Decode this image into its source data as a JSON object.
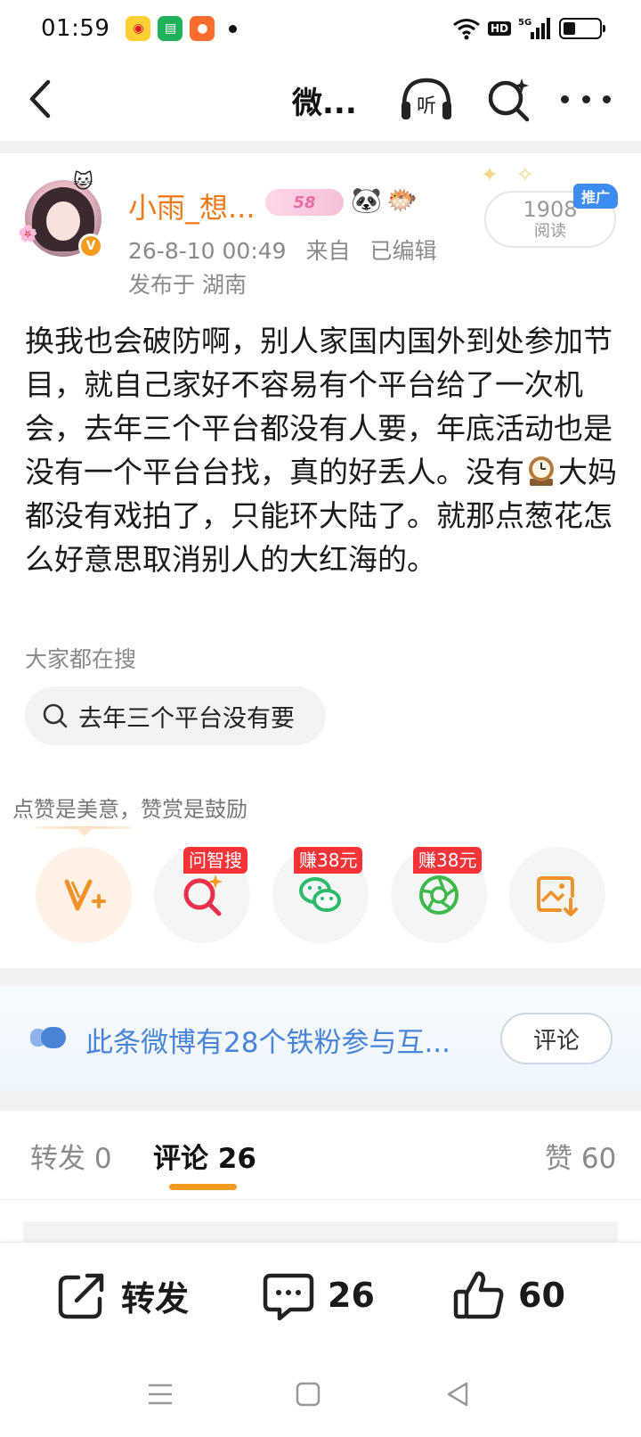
{
  "status_bar": {
    "time": "01:59",
    "network": "5G",
    "hd": "HD",
    "battery_percent": 35
  },
  "nav": {
    "title": "微...",
    "listen_label": "听"
  },
  "post": {
    "user_name": "小雨_想...",
    "level": "58",
    "verified": "V",
    "timestamp": "26-8-10 00:49",
    "source": "来自",
    "edited": "已编辑",
    "location": "发布于 湖南",
    "promo": {
      "count": "1908",
      "count_label": "阅读",
      "tag": "推广"
    },
    "text_part1": "换我也会破防啊，别人家国内国外到处参加节目，就自己家好不容易有个平台给了一次机会，去年三个平台都没有人要，年底活动也是没有一个平台台找，真的好丢人。没有",
    "text_part2": "大妈都没有戏拍了，只能环大陆了。就那点葱花怎么好意思取消别人的大红海的。",
    "search_caption": "大家都在搜",
    "search_chip": "去年三个平台没有要"
  },
  "encourage": {
    "text": "点赞是美意，赞赏是鼓励"
  },
  "actions": [
    {
      "name": "reward",
      "icon": "v-plus-icon",
      "tag": ""
    },
    {
      "name": "ask-search",
      "icon": "ai-search-icon",
      "tag": "问智搜"
    },
    {
      "name": "wechat",
      "icon": "wechat-icon",
      "tag": "赚38元"
    },
    {
      "name": "moments",
      "icon": "moments-icon",
      "tag": "赚38元"
    },
    {
      "name": "save-image",
      "icon": "image-download-icon",
      "tag": ""
    }
  ],
  "fans_banner": {
    "text": "此条微博有28个铁粉参与互...",
    "button": "评论"
  },
  "tabs": {
    "repost": "转发 0",
    "comment": "评论 26",
    "like": "赞 60"
  },
  "bottom_bar": {
    "repost": "转发",
    "comment": "26",
    "like": "60"
  },
  "colors": {
    "accent_orange": "#f59b1f",
    "username_orange": "#ee7a19",
    "link_blue": "#4a84d6",
    "tag_red": "#f5343a",
    "promo_blue": "#3d8cf0"
  }
}
